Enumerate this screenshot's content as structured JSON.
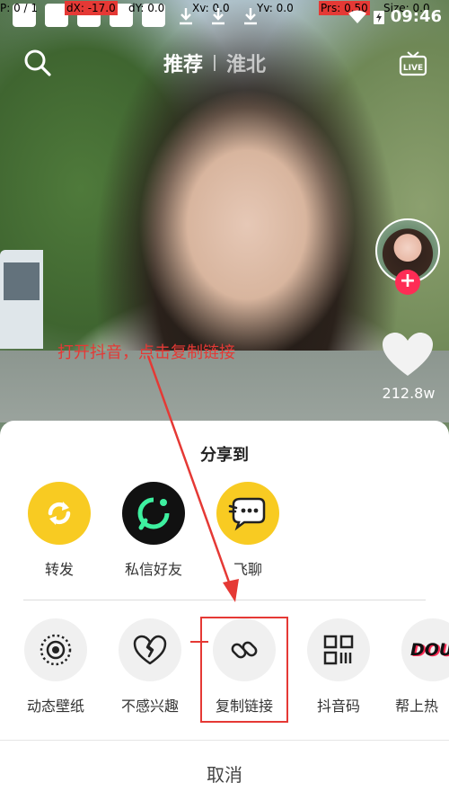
{
  "debug": {
    "pointer": "P: 0 / 1",
    "dx": "dX: -17.0",
    "dy": "dY: 0.0",
    "xv": "Xv: 0.0",
    "yv": "Yv: 0.0",
    "prs": "Prs: 0.50",
    "size": "Size: 0.0"
  },
  "status": {
    "time": "09:46"
  },
  "nav": {
    "tab_active": "推荐",
    "tab_inactive": "淮北",
    "live_label": "LIVE"
  },
  "side": {
    "like_count": "212.8w"
  },
  "annotation": {
    "text": "打开抖音，点击复制链接"
  },
  "share": {
    "title": "分享到",
    "row1": [
      {
        "label": "转发",
        "icon": "repost-icon"
      },
      {
        "label": "私信好友",
        "icon": "message-friend-icon"
      },
      {
        "label": "飞聊",
        "icon": "feiliao-chat-icon"
      }
    ],
    "row2": [
      {
        "label": "动态壁纸",
        "icon": "live-wallpaper-icon"
      },
      {
        "label": "不感兴趣",
        "icon": "broken-heart-icon"
      },
      {
        "label": "复制链接",
        "icon": "link-icon"
      },
      {
        "label": "抖音码",
        "icon": "qr-code-icon"
      },
      {
        "label": "帮上热",
        "icon": "dou-plus-icon",
        "logo_text": "DOU"
      }
    ],
    "cancel": "取消"
  },
  "colors": {
    "accent_red": "#e53935",
    "follow_pink": "#fe2c55",
    "repost_yellow": "#f8cb22",
    "feiliao_yellow": "#f8cb22"
  }
}
